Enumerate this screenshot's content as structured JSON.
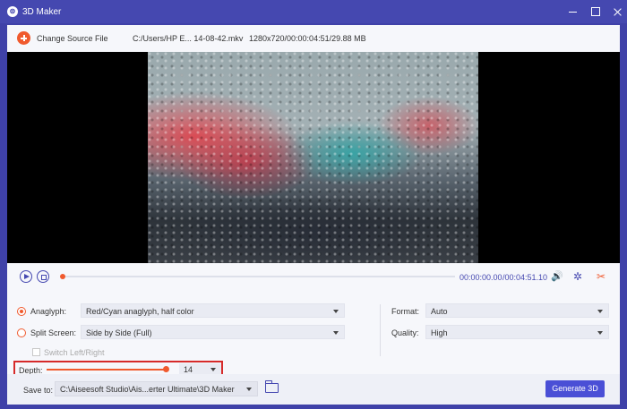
{
  "window": {
    "title": "3D Maker"
  },
  "topbar": {
    "change_source_label": "Change Source File",
    "file_path": "C:/Users/HP E... 14-08-42.mkv",
    "file_info": "1280x720/00:00:04:51/29.88 MB"
  },
  "playback": {
    "current_time": "00:00:00.00",
    "total_time": "/00:04:51.10",
    "progress": 0.0
  },
  "settings": {
    "anaglyph_label": "Anaglyph:",
    "anaglyph_value": "Red/Cyan anaglyph, half color",
    "anaglyph_selected": true,
    "split_label": "Split Screen:",
    "split_value": "Side by Side (Full)",
    "split_selected": false,
    "switch_label": "Switch Left/Right",
    "depth_label": "Depth:",
    "depth_value": "14",
    "format_label": "Format:",
    "format_value": "Auto",
    "quality_label": "Quality:",
    "quality_value": "High"
  },
  "bottombar": {
    "save_label": "Save to:",
    "save_path": "C:\\Aiseesoft Studio\\Ais...erter Ultimate\\3D Maker",
    "generate_label": "Generate 3D"
  },
  "colors": {
    "accent": "#f05a2e",
    "brand": "#4548b0",
    "button": "#4a4fd6"
  },
  "icons": [
    "app-logo-icon",
    "add-icon",
    "play-icon",
    "stop-icon",
    "volume-icon",
    "effects-icon",
    "cut-icon",
    "folder-icon"
  ]
}
